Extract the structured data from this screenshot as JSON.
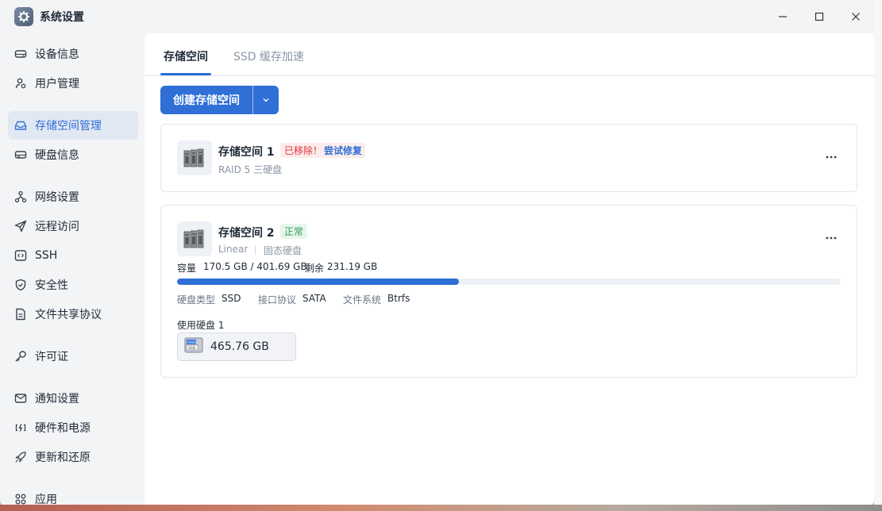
{
  "window": {
    "title": "系统设置",
    "minimize_icon": "minimize-icon",
    "maximize_icon": "maximize-icon",
    "close_icon": "close-icon"
  },
  "sidebar": {
    "items": [
      {
        "label": "设备信息",
        "icon": "hard-drive-icon"
      },
      {
        "label": "用户管理",
        "icon": "users-icon"
      },
      {
        "label": "存储空间管理",
        "icon": "inbox-icon",
        "active": true
      },
      {
        "label": "硬盘信息",
        "icon": "disk-icon"
      },
      {
        "label": "网络设置",
        "icon": "network-icon"
      },
      {
        "label": "远程访问",
        "icon": "send-icon"
      },
      {
        "label": "SSH",
        "icon": "ssh-terminal-icon"
      },
      {
        "label": "安全性",
        "icon": "shield-icon"
      },
      {
        "label": "文件共享协议",
        "icon": "file-icon"
      },
      {
        "label": "许可证",
        "icon": "key-icon"
      },
      {
        "label": "通知设置",
        "icon": "mail-icon"
      },
      {
        "label": "硬件和电源",
        "icon": "battery-icon"
      },
      {
        "label": "更新和还原",
        "icon": "rocket-icon"
      },
      {
        "label": "应用",
        "icon": "apps-grid-icon"
      }
    ]
  },
  "main": {
    "tabs": [
      {
        "label": "存储空间",
        "active": true
      },
      {
        "label": "SSD 缓存加速",
        "active": false
      }
    ],
    "create_button": "创建存储空间",
    "pools": [
      {
        "name": "存储空间 1",
        "status_error": "已移除！",
        "repair_link": "尝试修复",
        "subtitle": "RAID 5 三硬盘"
      },
      {
        "name": "存储空间 2",
        "status_ok": "正常",
        "type": "Linear",
        "media": "固态硬盘",
        "capacity_label": "容量",
        "capacity_value": "170.5 GB / 401.69 GB",
        "remaining_label": "剩余",
        "remaining_value": "231.19 GB",
        "usage_fraction": 0.4245,
        "disk_type_label": "硬盘类型",
        "disk_type_value": "SSD",
        "interface_label": "接口协议",
        "interface_value": "SATA",
        "fs_label": "文件系统",
        "fs_value": "Btrfs",
        "used_disks_label": "使用硬盘 1",
        "disk_size": "465.76 GB"
      }
    ]
  },
  "colors": {
    "accent": "#2f6fd6",
    "error": "#e0353b",
    "success": "#2e9b58"
  }
}
